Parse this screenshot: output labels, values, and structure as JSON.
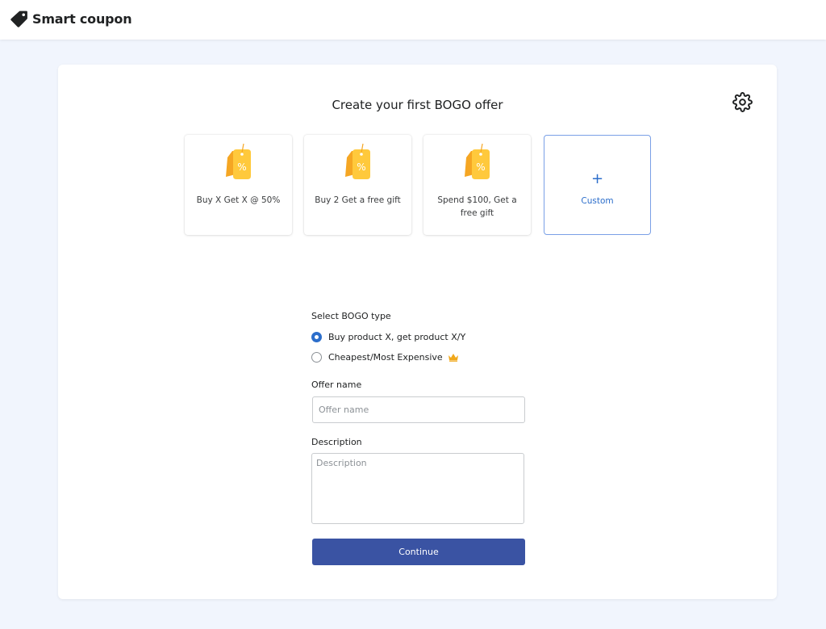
{
  "app": {
    "title": "Smart coupon",
    "logo_icon": "tag-icon"
  },
  "header": {
    "settings_icon": "gear-icon"
  },
  "page": {
    "title": "Create your first BOGO offer"
  },
  "templates": [
    {
      "label": "Buy X Get X @ 50%",
      "icon": "discount-tag-icon"
    },
    {
      "label": "Buy 2 Get a free gift",
      "icon": "discount-tag-icon"
    },
    {
      "label": "Spend $100, Get a free gift",
      "icon": "discount-tag-icon"
    },
    {
      "label": "Custom",
      "icon": "plus-icon",
      "symbol": "+"
    }
  ],
  "form": {
    "bogo_type_label": "Select BOGO type",
    "bogo_options": [
      {
        "label": "Buy product X, get product X/Y",
        "selected": true
      },
      {
        "label": "Cheapest/Most Expensive",
        "selected": false,
        "badge_icon": "crown-icon"
      }
    ],
    "offer_name": {
      "label": "Offer name",
      "placeholder": "Offer name",
      "value": ""
    },
    "description": {
      "label": "Description",
      "placeholder": "Description",
      "value": ""
    },
    "continue_label": "Continue"
  },
  "colors": {
    "accent": "#2c6ecb",
    "primary_button": "#3a53a3",
    "tag_yellow": "#ffc93c",
    "tag_orange": "#f5a623",
    "crown": "#f0a81b",
    "background": "#f1f5fd"
  }
}
